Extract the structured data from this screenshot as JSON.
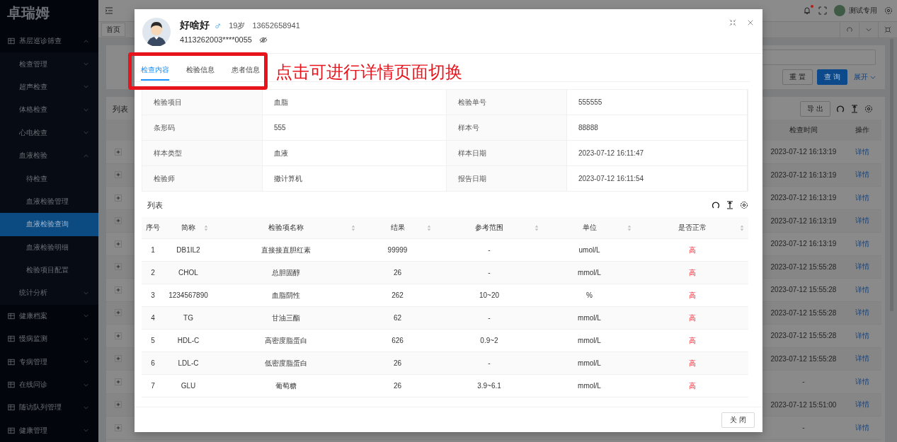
{
  "sidebar": {
    "logo": "卓瑞姆",
    "menu": [
      {
        "label": "基层巡诊筛查",
        "expanded": true,
        "children": [
          {
            "label": "检查管理",
            "expanded": false
          },
          {
            "label": "超声检查",
            "expanded": false
          },
          {
            "label": "体格检查",
            "expanded": false
          },
          {
            "label": "心电检查",
            "expanded": false
          },
          {
            "label": "血液检验",
            "expanded": true,
            "children": [
              {
                "label": "待检查",
                "selected": false
              },
              {
                "label": "血液检验管理",
                "selected": false
              },
              {
                "label": "血液检验查询",
                "selected": true
              },
              {
                "label": "血液检验明细",
                "selected": false
              },
              {
                "label": "检验项目配置",
                "selected": false
              }
            ]
          },
          {
            "label": "统计分析",
            "expanded": false
          }
        ]
      },
      {
        "label": "健康档案",
        "expanded": false
      },
      {
        "label": "慢病监测",
        "expanded": false
      },
      {
        "label": "专病管理",
        "expanded": false
      },
      {
        "label": "在线问诊",
        "expanded": false
      },
      {
        "label": "随访队列管理",
        "expanded": false
      },
      {
        "label": "健康管理",
        "expanded": false
      }
    ]
  },
  "header": {
    "notification_unread": true,
    "user": "测试专用"
  },
  "page_tabs": [
    {
      "label": "首页",
      "selected": false
    }
  ],
  "search": {
    "buttons": [
      "重 置",
      "查 询"
    ],
    "expand": "展开"
  },
  "records": {
    "title": "列表",
    "export": "导 出",
    "columns": [
      "检查时间",
      "操作"
    ],
    "rows": [
      {
        "time": "2023-07-12 16:13:19",
        "action": "详情"
      },
      {
        "time": "2023-07-12 16:13:19",
        "action": "详情"
      },
      {
        "time": "2023-07-12 16:13:19",
        "action": "详情"
      },
      {
        "time": "2023-07-12 16:13:19",
        "action": "详情"
      },
      {
        "time": "2023-07-12 16:13:19",
        "action": "详情"
      },
      {
        "time": "2023-07-12 15:55:28",
        "action": "详情"
      },
      {
        "time": "2023-07-12 15:55:28",
        "action": "详情"
      },
      {
        "time": "2023-07-12 15:55:28",
        "action": "详情"
      },
      {
        "time": "2023-07-12 15:55:28",
        "action": "详情"
      },
      {
        "time": "2023-07-12 15:55:28",
        "action": "详情"
      },
      {
        "time": "-",
        "action": "详情"
      },
      {
        "time": "2023-07-12 15:51:00",
        "action": "详情"
      },
      {
        "time": "-",
        "action": "详情"
      }
    ]
  },
  "modal": {
    "patient": {
      "name": "好啥好",
      "gender": "♂",
      "age": "19岁",
      "phone": "13652658941",
      "id_number": "4113262003****0055"
    },
    "tabs": [
      {
        "label": "检查内容",
        "selected": true
      },
      {
        "label": "检验信息",
        "selected": false
      },
      {
        "label": "患者信息",
        "selected": false
      }
    ],
    "annotation": {
      "text": "点击可进行详情页面切换"
    },
    "details": [
      {
        "label": "检验项目",
        "value": "血脂"
      },
      {
        "label": "检验单号",
        "value": "555555"
      },
      {
        "label": "条形码",
        "value": "555"
      },
      {
        "label": "样本号",
        "value": "88888"
      },
      {
        "label": "样本类型",
        "value": "血液"
      },
      {
        "label": "样本日期",
        "value": "2023-07-12 16:11:47"
      },
      {
        "label": "检验师",
        "value": "撒计算机"
      },
      {
        "label": "报告日期",
        "value": "2023-07-12 16:11:54"
      }
    ],
    "list_title": "列表",
    "columns": [
      {
        "label": "序号",
        "sortable": false
      },
      {
        "label": "简称",
        "sortable": true
      },
      {
        "label": "检验项名称",
        "sortable": true
      },
      {
        "label": "结果",
        "sortable": true
      },
      {
        "label": "参考范围",
        "sortable": true
      },
      {
        "label": "单位",
        "sortable": true
      },
      {
        "label": "是否正常",
        "sortable": true
      }
    ],
    "rows": [
      {
        "no": "1",
        "abbr": "DB1IL2",
        "name": "直接接直胆红素",
        "result": "99999",
        "range": "-",
        "unit": "umol/L",
        "flag": "高",
        "abnormal": true
      },
      {
        "no": "2",
        "abbr": "CHOL",
        "name": "总胆固醇",
        "result": "26",
        "range": "-",
        "unit": "mmol/L",
        "flag": "高",
        "abnormal": true
      },
      {
        "no": "3",
        "abbr": "1234567890",
        "name": "血脂阴性",
        "result": "262",
        "range": "10~20",
        "unit": "%",
        "flag": "高",
        "abnormal": true
      },
      {
        "no": "4",
        "abbr": "TG",
        "name": "甘油三酯",
        "result": "62",
        "range": "-",
        "unit": "mmol/L",
        "flag": "高",
        "abnormal": true
      },
      {
        "no": "5",
        "abbr": "HDL-C",
        "name": "高密度脂蛋白",
        "result": "626",
        "range": "0.9~2",
        "unit": "mmol/L",
        "flag": "高",
        "abnormal": true
      },
      {
        "no": "6",
        "abbr": "LDL-C",
        "name": "低密度脂蛋白",
        "result": "26",
        "range": "-",
        "unit": "mmol/L",
        "flag": "高",
        "abnormal": true
      },
      {
        "no": "7",
        "abbr": "GLU",
        "name": "葡萄糖",
        "result": "26",
        "range": "3.9~6.1",
        "unit": "mmol/L",
        "flag": "高",
        "abnormal": true
      }
    ],
    "close_button": "关 闭"
  }
}
